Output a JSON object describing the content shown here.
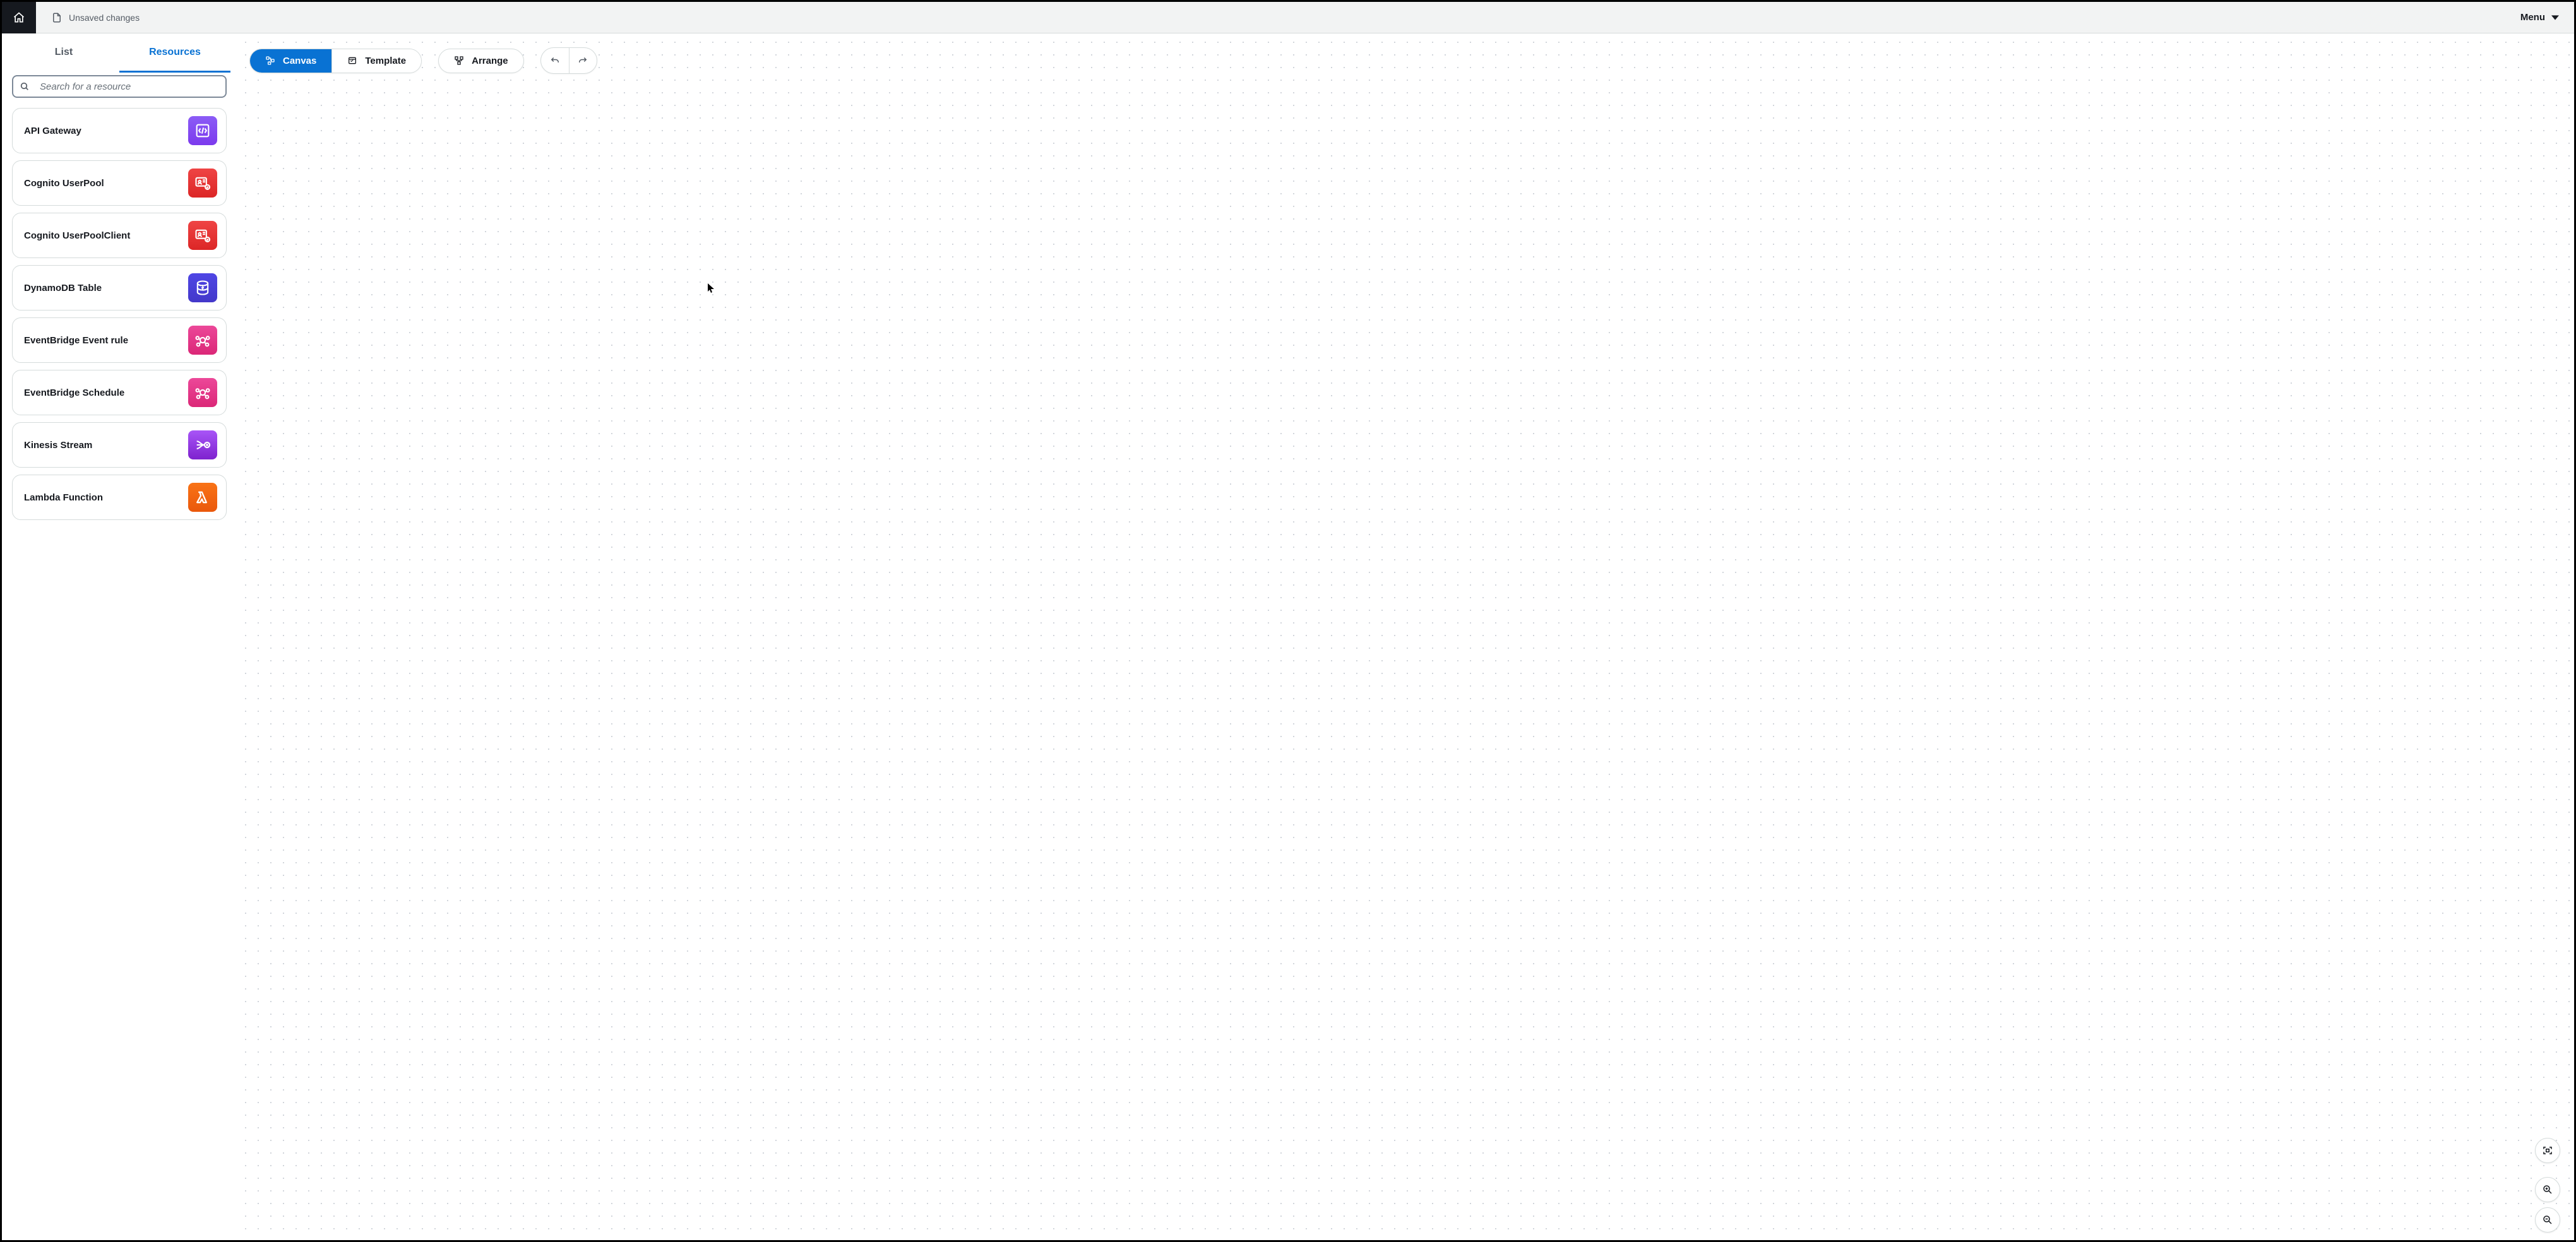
{
  "header": {
    "unsaved_label": "Unsaved changes",
    "menu_label": "Menu"
  },
  "sidebar": {
    "tabs": {
      "list": "List",
      "resources": "Resources"
    },
    "search": {
      "placeholder": "Search for a resource"
    },
    "resources": [
      {
        "label": "API Gateway",
        "color": "purple",
        "icon": "api-gateway-icon"
      },
      {
        "label": "Cognito UserPool",
        "color": "red",
        "icon": "cognito-icon"
      },
      {
        "label": "Cognito UserPoolClient",
        "color": "red",
        "icon": "cognito-icon"
      },
      {
        "label": "DynamoDB Table",
        "color": "blue",
        "icon": "dynamodb-icon"
      },
      {
        "label": "EventBridge Event rule",
        "color": "magenta",
        "icon": "eventbridge-icon"
      },
      {
        "label": "EventBridge Schedule",
        "color": "magenta",
        "icon": "eventbridge-icon"
      },
      {
        "label": "Kinesis Stream",
        "color": "violet",
        "icon": "kinesis-icon"
      },
      {
        "label": "Lambda Function",
        "color": "orange",
        "icon": "lambda-icon"
      }
    ]
  },
  "toolbar": {
    "canvas_label": "Canvas",
    "template_label": "Template",
    "arrange_label": "Arrange"
  }
}
